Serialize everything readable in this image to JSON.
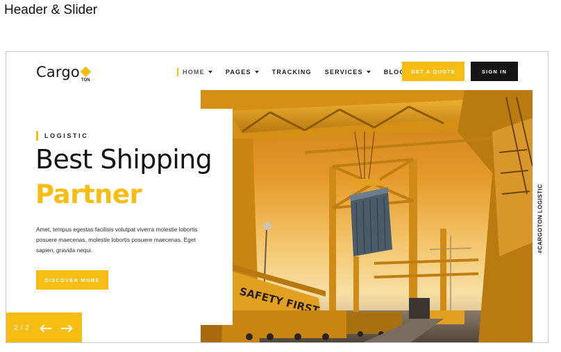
{
  "caption": "Header & Slider",
  "brand": {
    "name": "Cargo",
    "suffix": "TON",
    "accent_color": "#f7bd12",
    "dark_color": "#151515"
  },
  "nav": {
    "items": [
      {
        "label": "HOME",
        "has_dropdown": true,
        "active": true
      },
      {
        "label": "PAGES",
        "has_dropdown": true,
        "active": false
      },
      {
        "label": "TRACKING",
        "has_dropdown": false,
        "active": false
      },
      {
        "label": "SERVICES",
        "has_dropdown": true,
        "active": false
      },
      {
        "label": "BLOG",
        "has_dropdown": true,
        "active": false
      }
    ],
    "quote_label": "GET A QUOTE",
    "signin_label": "SIGN IN"
  },
  "hero": {
    "eyebrow": "LOGISTIC",
    "title": "Best Shipping",
    "title_highlight": "Partner",
    "description": "Amet, tempus egestas facilisis volutpat viverra molestie lobortis posuere maecenas. molestie lobortis posuere maecenas. Eget sapien, gravida nequi.",
    "cta_label": "DISCOVER MORE",
    "image_icon": "port-crane-container-photo",
    "side_label": "#CARGOTON LOGISTIC"
  },
  "slider": {
    "current": "2",
    "separator": "/",
    "total": "2",
    "prev_icon": "arrow-left-icon",
    "next_icon": "arrow-right-icon"
  }
}
